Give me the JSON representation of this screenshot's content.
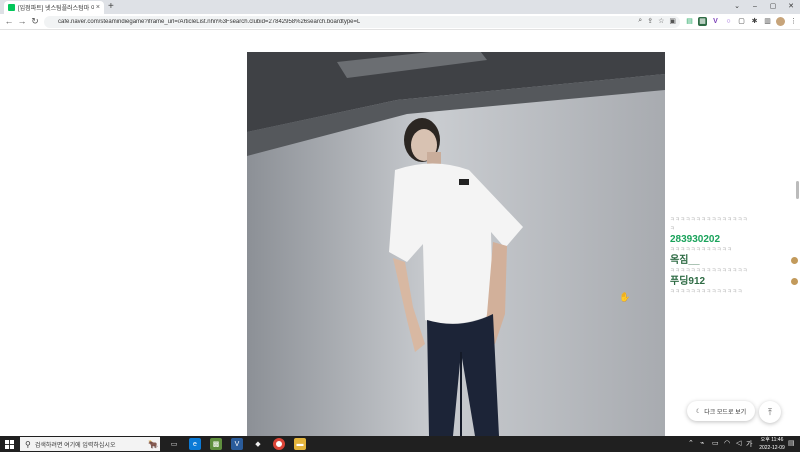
{
  "browser": {
    "tab_title": "[입점파트] 넷스팀플러스텀마 이미",
    "tab_close": "×",
    "new_tab": "+",
    "url": "cafe.naver.com/steamindiegame?iframe_url=/ArticleList.nhn%3Fsearch.clubid=27842958%26search.boardtype=L",
    "window_controls": {
      "minimize": "–",
      "maximize": "▢",
      "close": "✕"
    }
  },
  "chat": {
    "noise_1": "ㅋㅋㅋㅋㅋㅋㅋㅋㅋㅋㅋㅋㅋㅋㅋ",
    "noise_2": "ㅋ",
    "user_1": "283930202",
    "noise_3": "ㅋㅋㅋㅋㅋㅋㅋㅋㅋㅋㅋㅋ",
    "user_2": "옥짐__",
    "noise_4": "ㅋㅋㅋㅋㅋㅋㅋㅋㅋㅋㅋㅋㅋㅋㅋ",
    "user_3": "푸딩912",
    "noise_5": "ㅋㅋㅋㅋㅋㅋㅋㅋㅋㅋㅋㅋㅋㅋ",
    "user_colors": {
      "user_1": "#1aa35b",
      "user_2": "#2e6b44",
      "user_3": "#2e6b44"
    }
  },
  "buttons": {
    "dark_mode": "다크 모드로 보기",
    "scroll_top": "⤒"
  },
  "taskbar": {
    "search_placeholder": "검색하려면 여기에 입력하십시오",
    "time": "오후 11:46",
    "date": "2022-12-09"
  },
  "colors": {
    "accent": "#03c75a",
    "taskbar": "#202020"
  }
}
